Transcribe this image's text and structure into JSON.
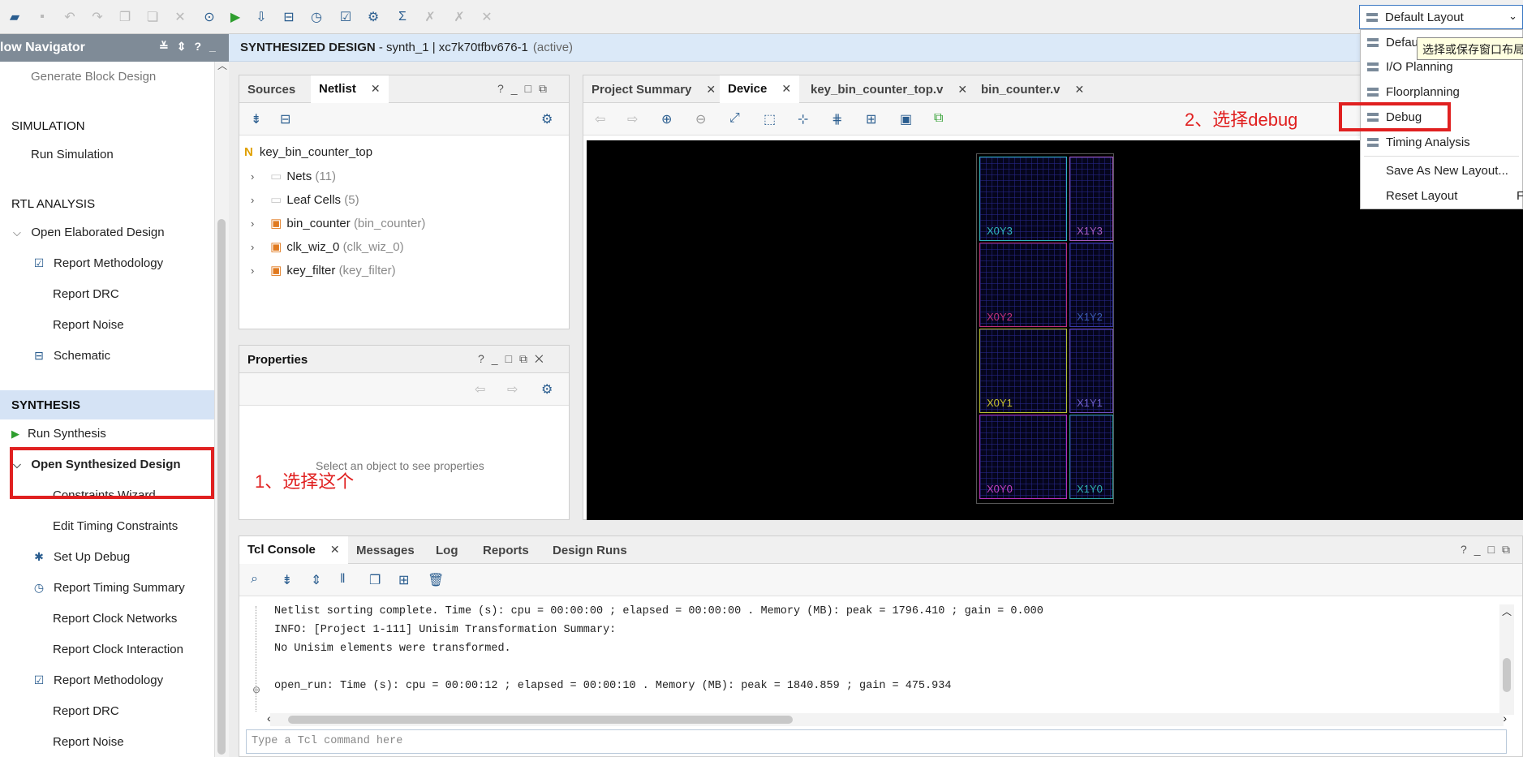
{
  "flow_navigator": {
    "title": "low Navigator",
    "items": [
      {
        "label": "Generate Block Design"
      },
      {
        "label": "SIMULATION"
      },
      {
        "label": "Run Simulation"
      },
      {
        "label": "RTL ANALYSIS"
      },
      {
        "label": "Open Elaborated Design"
      },
      {
        "label": "Report Methodology"
      },
      {
        "label": "Report DRC"
      },
      {
        "label": "Report Noise"
      },
      {
        "label": "Schematic"
      },
      {
        "label": "SYNTHESIS"
      },
      {
        "label": "Run Synthesis"
      },
      {
        "label": "Open Synthesized Design"
      },
      {
        "label": "Constraints Wizard"
      },
      {
        "label": "Edit Timing Constraints"
      },
      {
        "label": "Set Up Debug"
      },
      {
        "label": "Report Timing Summary"
      },
      {
        "label": "Report Clock Networks"
      },
      {
        "label": "Report Clock Interaction"
      },
      {
        "label": "Report Methodology"
      },
      {
        "label": "Report DRC"
      },
      {
        "label": "Report Noise"
      }
    ]
  },
  "header": {
    "title": "SYNTHESIZED DESIGN",
    "subtitle": " - synth_1 | xc7k70tfbv676-1",
    "status": "(active)"
  },
  "layout_select": {
    "value": "Default Layout"
  },
  "sources_panel": {
    "tabs": [
      "Sources",
      "Netlist"
    ],
    "root": "key_bin_counter_top",
    "rows": [
      {
        "name": "Nets",
        "detail": "(11)"
      },
      {
        "name": "Leaf Cells",
        "detail": "(5)"
      },
      {
        "name": "bin_counter",
        "detail": "(bin_counter)"
      },
      {
        "name": "clk_wiz_0",
        "detail": "(clk_wiz_0)"
      },
      {
        "name": "key_filter",
        "detail": "(key_filter)"
      }
    ]
  },
  "properties_panel": {
    "title": "Properties",
    "empty_text": "Select an object to see properties"
  },
  "device_panel": {
    "tabs": [
      "Project Summary",
      "Device",
      "key_bin_counter_top.v",
      "bin_counter.v"
    ],
    "regions": [
      "X0Y3",
      "X1Y3",
      "X0Y2",
      "X1Y2",
      "X0Y1",
      "X1Y1",
      "X0Y0",
      "X1Y0"
    ]
  },
  "console": {
    "tabs": [
      "Tcl Console",
      "Messages",
      "Log",
      "Reports",
      "Design Runs"
    ],
    "lines": [
      "Netlist sorting complete. Time (s): cpu = 00:00:00 ; elapsed = 00:00:00 . Memory (MB): peak = 1796.410 ; gain = 0.000",
      "INFO: [Project 1-111] Unisim Transformation Summary:",
      "No Unisim elements were transformed.",
      "",
      "open_run: Time (s): cpu = 00:00:12 ; elapsed = 00:00:10 . Memory (MB): peak = 1840.859 ; gain = 475.934"
    ],
    "input_placeholder": "Type a Tcl command here"
  },
  "layout_menu": {
    "items": [
      "Default",
      "I/O Planning",
      "Floorplanning",
      "Debug",
      "Timing Analysis",
      "Save As New Layout...",
      "Reset Layout"
    ],
    "shortcut_tail": "F",
    "tooltip": "选择或保存窗口布局"
  },
  "annotations": {
    "step1": "1、选择这个",
    "step2": "2、选择debug"
  },
  "colors": {
    "annotation": "#e02020",
    "accent": "#3b78c3"
  }
}
